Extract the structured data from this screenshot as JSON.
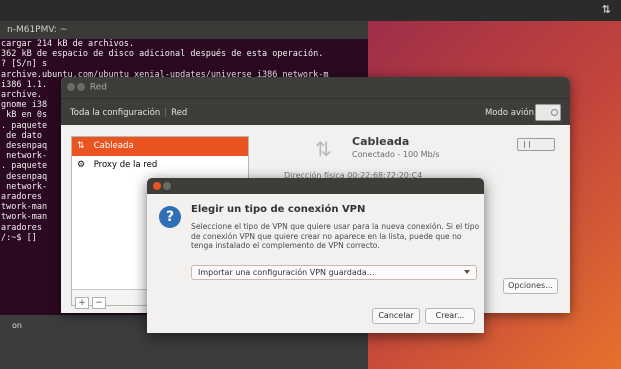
{
  "topbar": {
    "network_indicator": "⇅"
  },
  "terminal": {
    "title": "n-M61PMV: ~",
    "lines": [
      "cargar 214 kB de archivos.",
      "362 kB de espacio de disco adicional después de esta operación.",
      "? [S/n] s",
      "archive.ubuntu.com/ubuntu xenial-updates/universe i386 network-m",
      "i386 1.1.",
      "archive.",
      "gnome i38",
      " kB en 0s",
      ". paquete",
      " de dato",
      "",
      " desenpaq",
      "",
      " network-",
      ". paquete",
      "",
      " desenpaq",
      "",
      " network-",
      "aradores ",
      "twork-man",
      "twork-man",
      "aradores ",
      "/:~$ []"
    ],
    "bottom_text": "on"
  },
  "network_window": {
    "title": "Red",
    "breadcrumb_all": "Toda la configuración",
    "breadcrumb_current": "Red",
    "airplane_mode_label": "Modo avión",
    "sidebar": [
      {
        "label": "Cableada",
        "icon": "⇅",
        "selected": true
      },
      {
        "label": "Proxy de la red",
        "icon": "⚙",
        "selected": false
      }
    ],
    "add_button": "+",
    "remove_button": "−",
    "detail": {
      "icon": "⇅",
      "title": "Cableada",
      "status": "Conectado - 100 Mb/s",
      "hardware_address": "Dirección física  00:22:68:72:20:C4"
    },
    "options_button": "Opciones..."
  },
  "vpn_dialog": {
    "icon": "?",
    "heading": "Elegir un tipo de conexión VPN",
    "body": "Seleccione el tipo de VPN que quiere usar para la nueva conexión. Si el tipo de conexión VPN que quiere crear no aparece en la lista, puede que no tenga instalado el complemento de VPN correcto.",
    "select_value": "Importar una configuración VPN guardada...",
    "cancel_button": "Cancelar",
    "create_button": "Crear..."
  },
  "colors": {
    "accent": "#e95420",
    "terminal_bg": "#2c0922",
    "titlebar": "#3e3d39",
    "question_icon": "#2e6fb5"
  }
}
